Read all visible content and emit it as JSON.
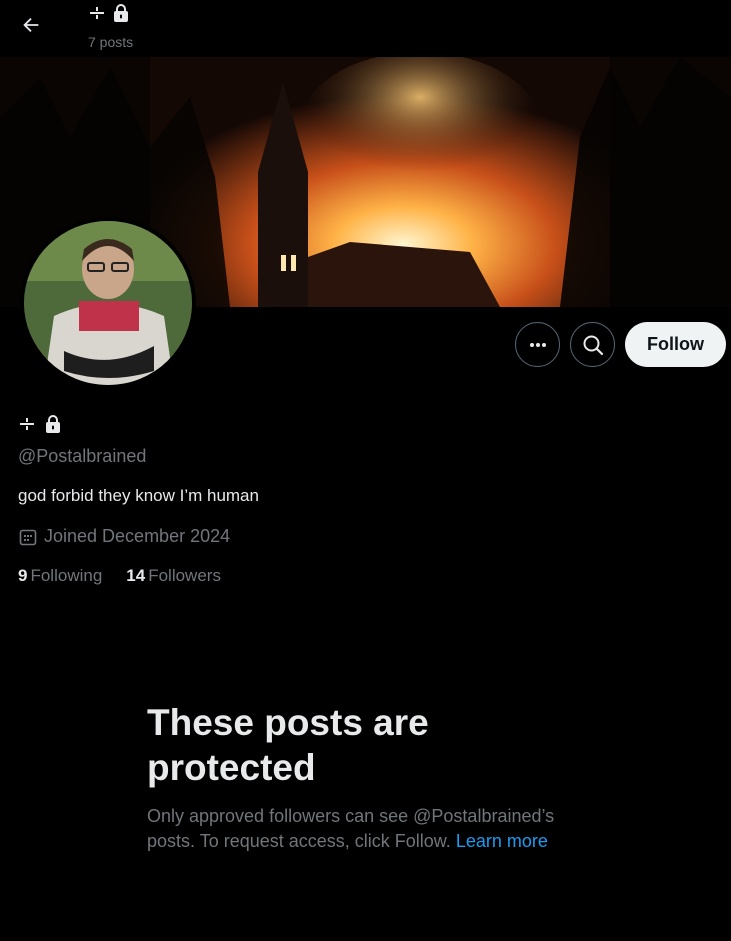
{
  "header": {
    "name_glyph": "⌖🔒",
    "post_count": "7 posts"
  },
  "profile": {
    "name_glyph": "⌖🔒",
    "handle": "@Postalbrained",
    "bio": "god forbid they know I’m human",
    "joined": "Joined December 2024",
    "following_count": "9",
    "following_label": "Following",
    "followers_count": "14",
    "followers_label": "Followers"
  },
  "actions": {
    "follow_label": "Follow",
    "more_icon": "more-horizontal-icon",
    "search_icon": "search-icon"
  },
  "protected": {
    "title": "These posts are protected",
    "body": "Only approved followers can see @Postalbrained’s posts. To request access, click Follow.",
    "link": "Learn more"
  },
  "colors": {
    "background": "#000000",
    "text": "#e7e9ea",
    "muted": "#71767b",
    "link": "#1d9bf0",
    "follow_bg": "#eff3f4"
  }
}
